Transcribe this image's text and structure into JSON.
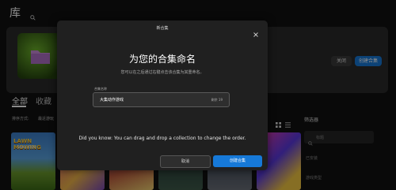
{
  "header": {
    "title": "库"
  },
  "banner": {
    "button_close": "关闭",
    "button_create": "创建合集"
  },
  "tabs": [
    {
      "label": "全部"
    },
    {
      "label": "收藏"
    }
  ],
  "sort": {
    "label": "排序方式:",
    "value": "最近游玩"
  },
  "sidebar": {
    "title": "筛选器",
    "search_placeholder": "标题",
    "installed": "已安装",
    "genre": "游戏类型"
  },
  "games": [
    {
      "title": "LAWN MOWING",
      "subtitle": "SIMULATOR"
    }
  ],
  "modal": {
    "title": "新合集",
    "heading": "为您的合集命名",
    "subtitle": "您可以在之后通过右键点击该合集为其重命名。",
    "field_label": "合集名称",
    "field_value": "大集动作游戏",
    "field_count": "剩余 19",
    "tip": "Did you know: You can drag and drop a collection to change the order.",
    "cancel_label": "取消",
    "create_label": "创建合集"
  },
  "colors": {
    "accent": "#1679d8",
    "modal_bg": "#202020",
    "page_bg": "#121212"
  }
}
